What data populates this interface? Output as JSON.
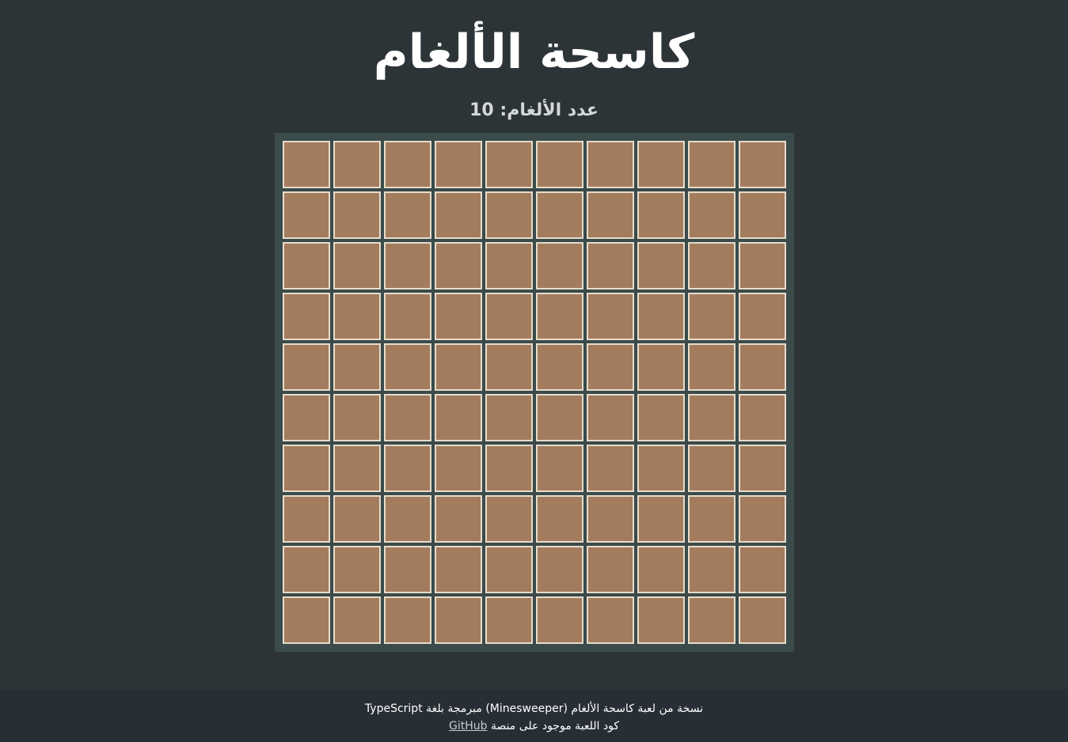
{
  "header": {
    "title": "كاسحة الألغام"
  },
  "status": {
    "mine_count_label": "عدد الألغام: 10"
  },
  "board": {
    "rows": 10,
    "columns": 10,
    "cell_state": "covered",
    "colors": {
      "background": "#3b4a4a",
      "cell_fill": "#a37c5e",
      "cell_border": "#e6dccb"
    }
  },
  "footer": {
    "line1": "نسخة من لعبة كاسحة الألغام (Minesweeper) مبرمجة بلغة TypeScript",
    "line2_text": "كود اللعبة موجود على منصة",
    "link_label": "GitHub"
  },
  "colors": {
    "page_background": "#2d3438",
    "footer_background": "#272e35"
  }
}
